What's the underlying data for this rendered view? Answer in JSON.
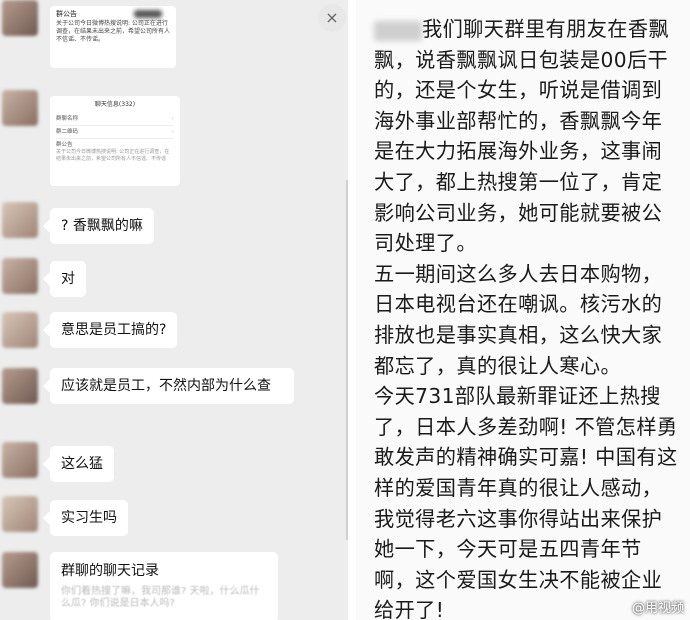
{
  "chat": {
    "notice": {
      "title": "群公告",
      "body": "关于公司今日微博热搜说明: 公司正在进行调查，在结果未出来之前，希望公司所有人不信谣、不传谣。"
    },
    "settings": {
      "header": "聊天信息(332)",
      "rows": [
        {
          "label": "群聊名称"
        },
        {
          "label": "群二维码"
        },
        {
          "label": "群公告",
          "sub": "关于公司今日微博热搜说明: 公司正在进行调查，在结果未出来之前，希望公司所有人不信谣、不传谣"
        }
      ]
    },
    "messages": [
      "? 香飘飘的嘛",
      "对",
      "意思是员工搞的?",
      "应该就是员工，不然内部为什么查",
      "这么猛",
      "实习生吗"
    ],
    "record": {
      "title": "群聊的聊天记录",
      "preview": "你们看热搜了嘛，我司那谁? 天啦，什么瓜什么瓜? 你们说是日本人吗?"
    }
  },
  "post": {
    "paragraphs": [
      "我们聊天群里有朋友在香飘飘，说香飘飘讽日包装是00后干的，还是个女生，听说是借调到海外事业部帮忙的，香飘飘今年是在大力拓展海外业务，这事闹大了，都上热搜第一位了，肯定影响公司业务，她可能就要被公司处理了。",
      "五一期间这么多人去日本购物，日本电视台还在嘲讽。核污水的排放也是事实真相，这么快大家都忘了，真的很让人寒心。",
      "今天731部队最新罪证还上热搜了，日本人多差劲啊! 不管怎样勇敢发声的精神确实可嘉! 中国有这样的爱国青年真的很让人感动，我觉得老六这事你得站出来保护她一下，今天可是五四青年节啊，这个爱国女生决不能被企业给开了!"
    ],
    "watermark": "@用视频",
    "close_icon": "×"
  }
}
